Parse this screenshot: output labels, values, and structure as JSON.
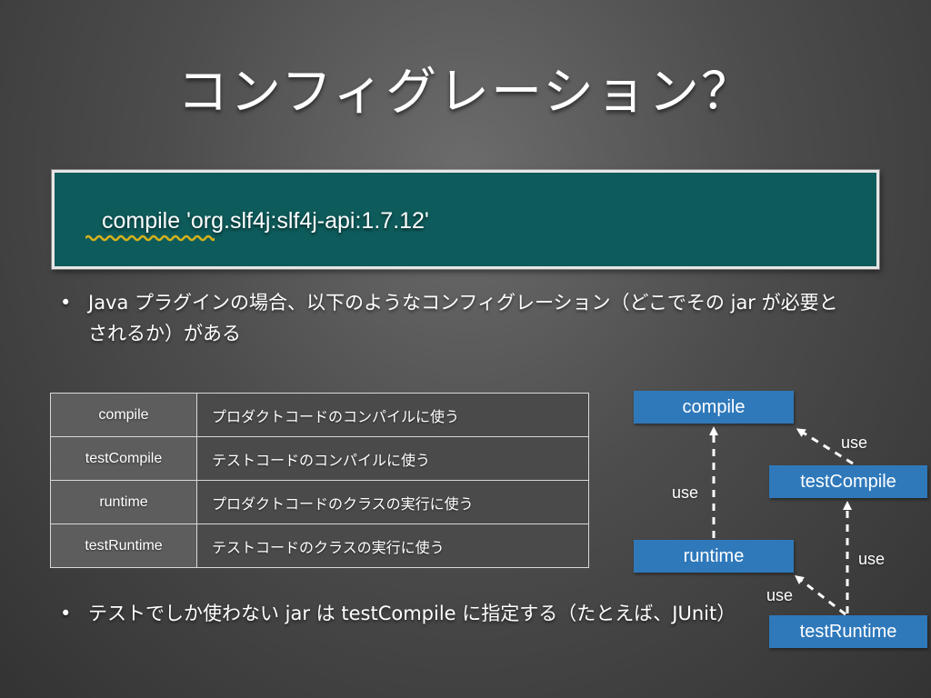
{
  "slide": {
    "title": "コンフィグレーション？",
    "code": "compile 'org.slf4j:slf4j-api:1.7.12'",
    "bullet_marker": "•",
    "bullets": [
      "Java プラグインの場合、以下のようなコンフィグレーション（どこでその jar が必要とされるか）がある",
      "テストでしか使わない jar は testCompile に指定する（たとえば、JUnit）"
    ]
  },
  "table": {
    "rows": [
      {
        "name": "compile",
        "desc": "プロダクトコードのコンパイルに使う"
      },
      {
        "name": "testCompile",
        "desc": "テストコードのコンパイルに使う"
      },
      {
        "name": "runtime",
        "desc": "プロダクトコードのクラスの実行に使う"
      },
      {
        "name": "testRuntime",
        "desc": "テストコードのクラスの実行に使う"
      }
    ]
  },
  "diagram": {
    "nodes": {
      "compile": "compile",
      "testCompile": "testCompile",
      "runtime": "runtime",
      "testRuntime": "testRuntime"
    },
    "edge_label": "use",
    "node_color": "#2f79bb"
  },
  "colors": {
    "code_background": "#0e5b5b",
    "squiggle": "#d6b21a"
  }
}
